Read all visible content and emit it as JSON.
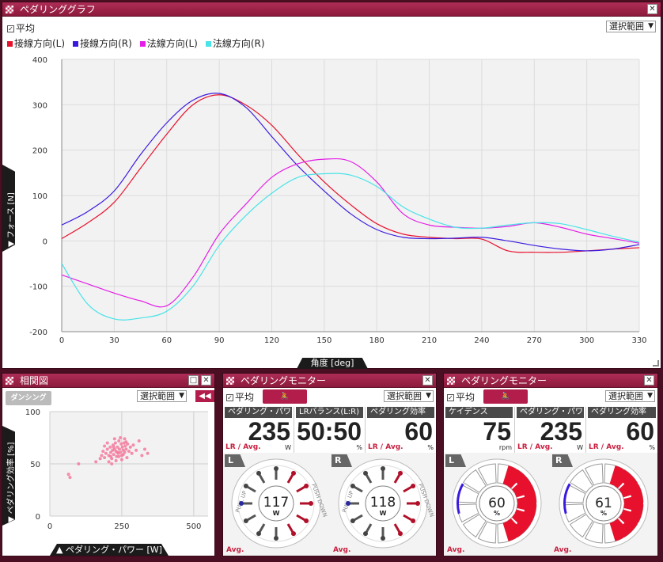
{
  "main": {
    "title": "ペダリンググラフ",
    "average_label": "平均",
    "average_checked": true,
    "range_select": "選択範囲",
    "y_axis_tab": "▼ フォース [N]",
    "x_axis_tab": "角度 [deg]"
  },
  "chart_data": [
    {
      "type": "line",
      "x": [
        0,
        15,
        30,
        45,
        60,
        75,
        90,
        105,
        120,
        135,
        150,
        165,
        180,
        195,
        210,
        225,
        240,
        255,
        270,
        285,
        300,
        315,
        330
      ],
      "xlim": [
        0,
        330
      ],
      "ylim": [
        -200,
        400
      ],
      "xticks": [
        0,
        30,
        60,
        90,
        120,
        150,
        180,
        210,
        240,
        270,
        300,
        330
      ],
      "yticks": [
        -200,
        -100,
        0,
        100,
        200,
        300,
        400
      ],
      "xlabel": "角度 [deg]",
      "ylabel": "フォース [N]",
      "grid": true,
      "legend": "top-left",
      "series": [
        {
          "name": "接線方向(L)",
          "color": "#e8112d",
          "values": [
            5,
            40,
            85,
            160,
            235,
            300,
            322,
            300,
            255,
            190,
            130,
            80,
            38,
            15,
            8,
            5,
            4,
            -22,
            -25,
            -25,
            -22,
            -18,
            -15
          ]
        },
        {
          "name": "接線方向(R)",
          "color": "#3a1adf",
          "values": [
            35,
            65,
            110,
            190,
            260,
            310,
            325,
            295,
            230,
            165,
            110,
            60,
            25,
            8,
            5,
            6,
            8,
            0,
            -10,
            -18,
            -22,
            -18,
            -8
          ]
        },
        {
          "name": "法線方向(L)",
          "color": "#e31ee6",
          "values": [
            -75,
            -95,
            -115,
            -132,
            -143,
            -80,
            15,
            80,
            140,
            170,
            180,
            175,
            130,
            60,
            35,
            30,
            28,
            32,
            40,
            30,
            15,
            5,
            -5
          ]
        },
        {
          "name": "法線方向(R)",
          "color": "#49e3e8",
          "values": [
            -50,
            -140,
            -172,
            -170,
            -155,
            -100,
            -10,
            55,
            105,
            140,
            148,
            145,
            120,
            75,
            48,
            30,
            28,
            35,
            40,
            38,
            25,
            10,
            -3
          ]
        }
      ]
    },
    {
      "type": "scatter",
      "xlim": [
        0,
        550
      ],
      "ylim": [
        0,
        100
      ],
      "xticks": [
        0,
        250,
        500
      ],
      "yticks": [
        0,
        50,
        100
      ],
      "xlabel": "ペダリング・パワー [W]",
      "ylabel": "ペダリング効率 [%]",
      "grid": true,
      "color": "#f47a9e",
      "points": [
        [
          65,
          40
        ],
        [
          70,
          37
        ],
        [
          100,
          50
        ],
        [
          160,
          52
        ],
        [
          175,
          55
        ],
        [
          180,
          58
        ],
        [
          185,
          62
        ],
        [
          190,
          56
        ],
        [
          195,
          60
        ],
        [
          200,
          64
        ],
        [
          205,
          58
        ],
        [
          210,
          66
        ],
        [
          212,
          61
        ],
        [
          215,
          55
        ],
        [
          218,
          63
        ],
        [
          220,
          68
        ],
        [
          222,
          59
        ],
        [
          225,
          64
        ],
        [
          228,
          70
        ],
        [
          230,
          62
        ],
        [
          232,
          57
        ],
        [
          235,
          66
        ],
        [
          238,
          60
        ],
        [
          240,
          72
        ],
        [
          242,
          64
        ],
        [
          245,
          61
        ],
        [
          248,
          69
        ],
        [
          250,
          58
        ],
        [
          252,
          66
        ],
        [
          255,
          63
        ],
        [
          258,
          70
        ],
        [
          260,
          61
        ],
        [
          262,
          67
        ],
        [
          265,
          64
        ],
        [
          268,
          56
        ],
        [
          270,
          69
        ],
        [
          275,
          62
        ],
        [
          280,
          66
        ],
        [
          285,
          60
        ],
        [
          290,
          68
        ],
        [
          300,
          63
        ],
        [
          310,
          72
        ],
        [
          320,
          58
        ],
        [
          330,
          64
        ],
        [
          340,
          60
        ],
        [
          205,
          52
        ],
        [
          215,
          50
        ],
        [
          230,
          53
        ],
        [
          250,
          54
        ],
        [
          200,
          70
        ],
        [
          225,
          74
        ],
        [
          245,
          75
        ],
        [
          260,
          74
        ],
        [
          190,
          67
        ],
        [
          240,
          57
        ],
        [
          255,
          59
        ],
        [
          265,
          71
        ],
        [
          235,
          61
        ],
        [
          222,
          66
        ],
        [
          212,
          57
        ]
      ]
    }
  ],
  "scatter_panel": {
    "title": "相関図",
    "logo": "ダンシング",
    "range_select": "選択範囲",
    "arrows": "◀◀",
    "y_axis_tab": "▼ ペダリング効率 [%]",
    "x_axis_tab": "▲ ペダリング・パワー [W]"
  },
  "monitor1": {
    "title": "ペダリングモニター",
    "average_label": "平均",
    "range_select": "選択範囲",
    "metrics": [
      {
        "label": "ペダリング・パワー",
        "value": "235",
        "sub": "LR / Avg.",
        "unit": "W"
      },
      {
        "label": "LRバランス(L:R)",
        "value": "50:50",
        "sub": "",
        "unit": "%"
      },
      {
        "label": "ペダリング効率",
        "value": "60",
        "sub": "LR / Avg.",
        "unit": "%"
      }
    ],
    "left": {
      "tab": "L",
      "value": "117",
      "unit": "W",
      "avg": "Avg."
    },
    "right": {
      "tab": "R",
      "value": "118",
      "unit": "W",
      "avg": "Avg."
    },
    "pull_up": "PULL UP",
    "push_down": "PUSH DOWN"
  },
  "monitor2": {
    "title": "ペダリングモニター",
    "average_label": "平均",
    "range_select": "選択範囲",
    "metrics": [
      {
        "label": "ケイデンス",
        "value": "75",
        "sub": "",
        "unit": "rpm"
      },
      {
        "label": "ペダリング・パワー",
        "value": "235",
        "sub": "LR / Avg.",
        "unit": "W"
      },
      {
        "label": "ペダリング効率",
        "value": "60",
        "sub": "LR / Avg.",
        "unit": "%"
      }
    ],
    "left": {
      "tab": "L",
      "value": "60",
      "unit": "%",
      "avg": "Avg."
    },
    "right": {
      "tab": "R",
      "value": "61",
      "unit": "%",
      "avg": "Avg."
    }
  },
  "colors": {
    "accent": "#a82550",
    "bg": "#4a0f22",
    "red": "#e8112d"
  }
}
